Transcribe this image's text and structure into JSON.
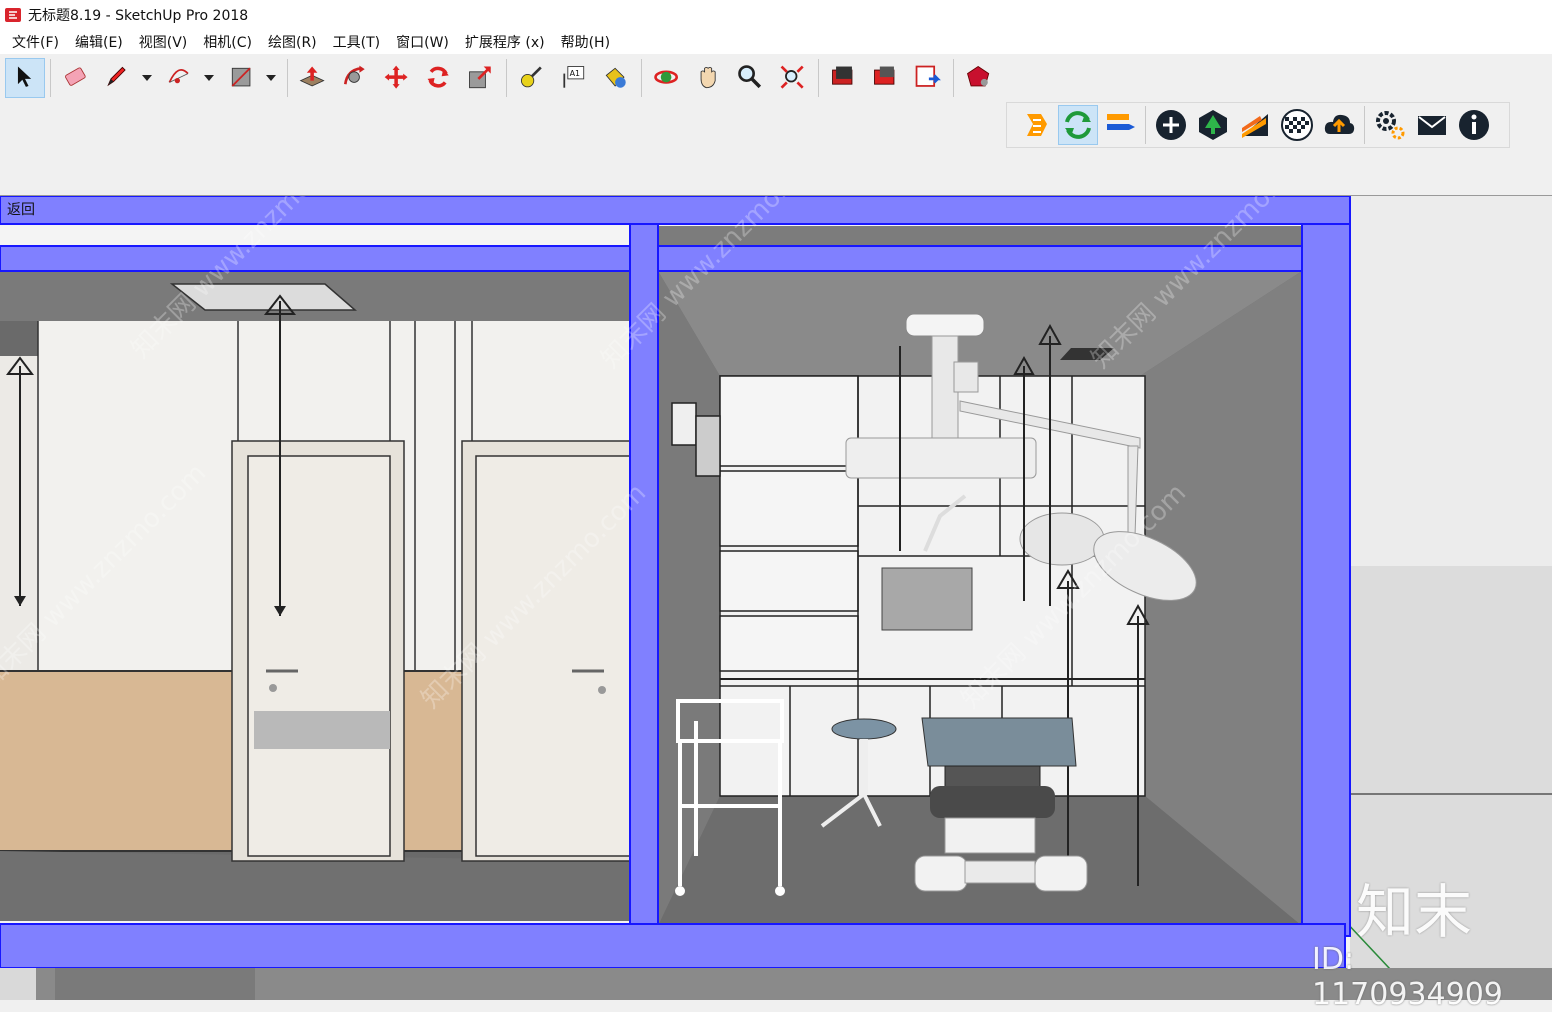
{
  "window": {
    "title": "无标题8.19 - SketchUp Pro 2018"
  },
  "menu": [
    {
      "label": "文件(F)"
    },
    {
      "label": "编辑(E)"
    },
    {
      "label": "视图(V)"
    },
    {
      "label": "相机(C)"
    },
    {
      "label": "绘图(R)"
    },
    {
      "label": "工具(T)"
    },
    {
      "label": "窗口(W)"
    },
    {
      "label": "扩展程序 (x)"
    },
    {
      "label": "帮助(H)"
    }
  ],
  "toolbar": {
    "tools": [
      "select-icon",
      "eraser-icon",
      "pencil-icon",
      "arc-icon",
      "rectangle-icon",
      "push-pull-icon",
      "follow-me-icon",
      "move-icon",
      "rotate-icon",
      "scale-icon",
      "tape-measure-icon",
      "text-icon",
      "paint-bucket-icon",
      "orbit-icon",
      "pan-icon",
      "zoom-icon",
      "zoom-extents-icon",
      "warehouse-icon",
      "extension-warehouse-icon",
      "layout-icon",
      "ruby-icon"
    ],
    "text_tool_label": "A1"
  },
  "toolbar2": {
    "tools": [
      "enscape-logo-icon",
      "enscape-sync-icon",
      "enscape-video-icon",
      "add-icon",
      "tree-icon",
      "material-icon",
      "checker-icon",
      "cloud-upload-icon",
      "settings-icon",
      "mail-icon",
      "info-icon"
    ]
  },
  "viewport": {
    "back_label": "返回"
  },
  "watermark": {
    "logo": "知末",
    "id": "ID: 1170934909",
    "diagonal": [
      "知末网 www.znzmo.com"
    ]
  }
}
